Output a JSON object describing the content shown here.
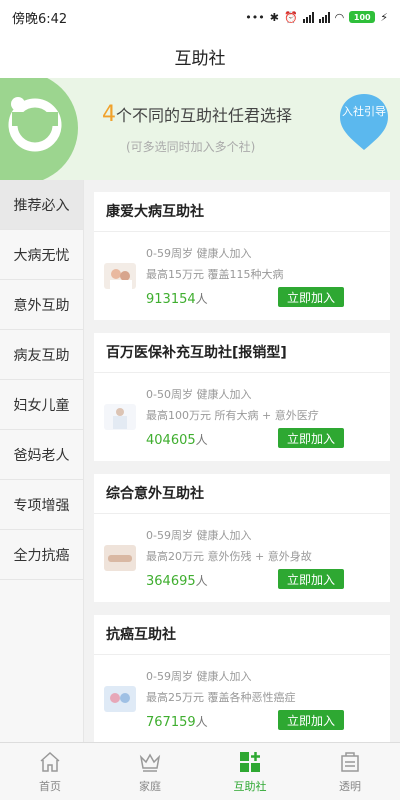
{
  "status_bar": {
    "time": "傍晚6:42",
    "dots": "•••",
    "battery": "100"
  },
  "title": "互助社",
  "banner": {
    "count": "4",
    "headline": "个不同的互助社任君选择",
    "sub": "(可多选同时加入多个社)",
    "guide": "入社引导"
  },
  "sidebar": {
    "items": [
      {
        "label": "推荐必入"
      },
      {
        "label": "大病无忧"
      },
      {
        "label": "意外互助"
      },
      {
        "label": "病友互助"
      },
      {
        "label": "妇女儿童"
      },
      {
        "label": "爸妈老人"
      },
      {
        "label": "专项增强"
      },
      {
        "label": "全力抗癌"
      }
    ]
  },
  "cards": [
    {
      "title": "康爱大病互助社",
      "age": "0-59周岁 健康人加入",
      "desc": "最高15万元 覆盖115种大病",
      "count": "913154",
      "unit": "人",
      "button": "立即加入"
    },
    {
      "title": "百万医保补充互助社[报销型]",
      "age": "0-50周岁 健康人加入",
      "desc": "最高100万元 所有大病 + 意外医疗",
      "count": "404605",
      "unit": "人",
      "button": "立即加入"
    },
    {
      "title": "综合意外互助社",
      "age": "0-59周岁 健康人加入",
      "desc": "最高20万元 意外伤残 + 意外身故",
      "count": "364695",
      "unit": "人",
      "button": "立即加入"
    },
    {
      "title": "抗癌互助社",
      "age": "0-59周岁 健康人加入",
      "desc": "最高25万元 覆盖各种恶性癌症",
      "count": "767159",
      "unit": "人",
      "button": "立即加入"
    }
  ],
  "tabbar": {
    "items": [
      {
        "label": "首页",
        "icon": "home-icon"
      },
      {
        "label": "家庭",
        "icon": "crown-icon"
      },
      {
        "label": "互助社",
        "icon": "grid-plus-icon"
      },
      {
        "label": "透明",
        "icon": "register-icon"
      }
    ]
  },
  "colors": {
    "accent": "#2ea832",
    "count": "#3fae2f",
    "highlight": "#f0a12b"
  }
}
